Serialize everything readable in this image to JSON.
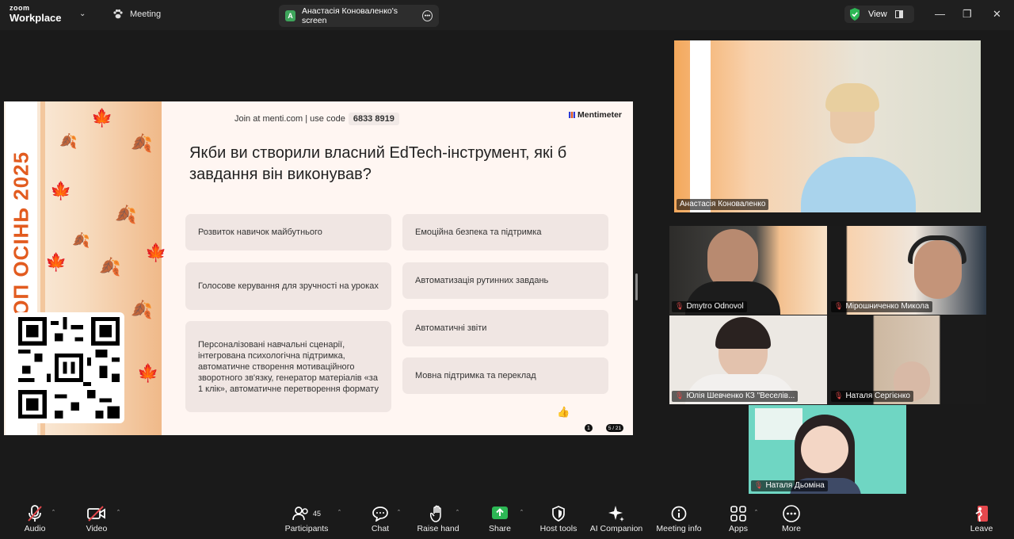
{
  "app": {
    "brand_top": "zoom",
    "brand_bottom": "Workplace"
  },
  "tabs": {
    "meeting": "Meeting",
    "screen_badge": "A",
    "screen": "Анастасія Коноваленко's screen"
  },
  "titlebar": {
    "view": "View"
  },
  "slide": {
    "join_text": "Join at menti.com | use code",
    "code": "6833 8919",
    "menti_brand": "Mentimeter",
    "vertical_text": "2025 ТОП ОСІНЬ 2025",
    "question": "Якби ви створили власний EdTech-інструмент, які б завдання він виконував?",
    "options_left": [
      "Розвиток навичок майбутнього",
      "Голосове керування для зручності на уроках",
      "Персоналізовані навчальні сценарії, інтегрована психологічна підтримка, автоматичне створення мотиваційного зворотного зв'язку, генератор матеріалів «за 1 клік», автоматичне перетворення формату"
    ],
    "options_right": [
      "Емоційна безпека та підтримка",
      "Автоматизація рутинних завдань",
      "Автоматичні звіти",
      "Мовна підтримка та переклад"
    ],
    "participants_count": "1",
    "page": "5 / 21"
  },
  "participants": {
    "presenter": "Анастасія Коноваленко",
    "tiles": [
      "Dmytro Odnovol",
      "Мірошниченко Микола",
      "Юлія Шевченко КЗ \"Веселів...",
      "Наталя Сергієнко",
      "Наталя Дьоміна"
    ]
  },
  "toolbar": {
    "audio": "Audio",
    "video": "Video",
    "participants": "Participants",
    "participants_count": "45",
    "chat": "Chat",
    "raise_hand": "Raise hand",
    "share": "Share",
    "host_tools": "Host tools",
    "ai_companion": "AI Companion",
    "meeting_info": "Meeting info",
    "apps": "Apps",
    "more": "More",
    "leave": "Leave"
  },
  "colors": {
    "accent_green": "#2db755",
    "leave_red": "#e5484d",
    "menti_orange": "#e25b1f"
  }
}
